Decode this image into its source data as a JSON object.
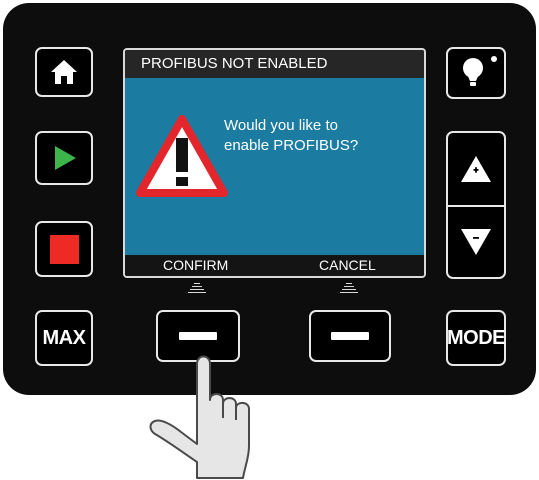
{
  "screen": {
    "title": "PROFIBUS NOT ENABLED",
    "message_line1": "Would you like to",
    "message_line2": "enable PROFIBUS?",
    "confirm_label": "CONFIRM",
    "cancel_label": "CANCEL",
    "warning_icon": "warning-triangle-icon"
  },
  "left_keys": [
    {
      "name": "home",
      "icon": "home-icon"
    },
    {
      "name": "start",
      "icon": "play-icon"
    },
    {
      "name": "stop",
      "icon": "stop-icon"
    },
    {
      "name": "max",
      "label": "MAX"
    }
  ],
  "right_keys": [
    {
      "name": "light",
      "icon": "lightbulb-icon"
    },
    {
      "name": "increase",
      "icon": "plus-up-triangle-icon"
    },
    {
      "name": "decrease",
      "icon": "minus-down-triangle-icon"
    },
    {
      "name": "mode",
      "label": "MODE"
    }
  ],
  "colors": {
    "screen_blue": "#1b7ba0",
    "play_green": "#3cb54a",
    "stop_red": "#ee2a24",
    "warning_red": "#e3262b"
  }
}
